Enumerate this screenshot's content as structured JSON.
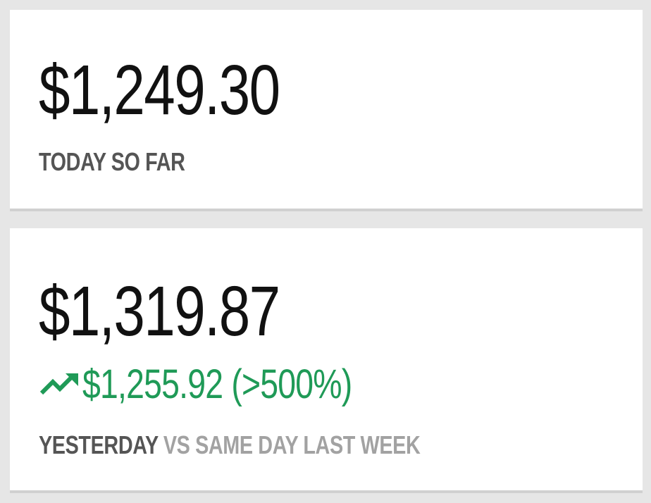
{
  "today": {
    "amount": "$1,249.30",
    "label": "TODAY SO FAR"
  },
  "yesterday": {
    "amount": "$1,319.87",
    "change": "$1,255.92 (>500%)",
    "change_icon": "trending-up-icon",
    "label_primary": "YESTERDAY",
    "label_secondary": " VS SAME DAY LAST WEEK"
  },
  "colors": {
    "background": "#e6e6e6",
    "card": "#ffffff",
    "amount_text": "#111111",
    "label_text": "#555555",
    "label_muted": "#a2a2a2",
    "positive": "#1f9a57"
  }
}
